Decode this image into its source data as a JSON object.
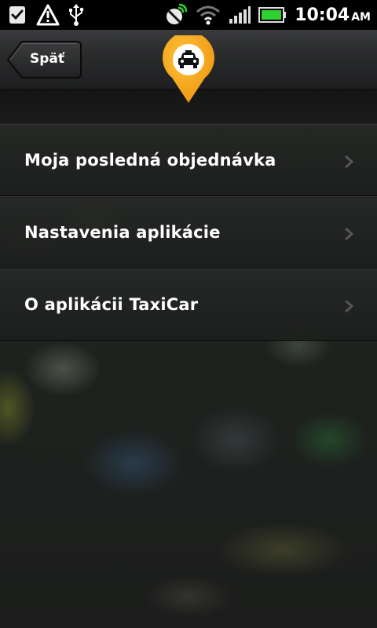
{
  "status_bar": {
    "time": "10:04",
    "ampm": "AM",
    "icons": [
      "checkmark-icon",
      "warning-icon",
      "usb-icon",
      "no-signal-satellite-icon",
      "wifi-icon",
      "cell-signal-icon",
      "battery-icon"
    ],
    "battery_color": "#2fd12f"
  },
  "header": {
    "back_label": "Späť",
    "logo_icon": "taxi-pin-icon",
    "accent_color": "#f7a318"
  },
  "menu": {
    "items": [
      {
        "label": "Moja posledná objednávka"
      },
      {
        "label": "Nastavenia aplikácie"
      },
      {
        "label": "O aplikácii TaxiCar"
      }
    ]
  }
}
